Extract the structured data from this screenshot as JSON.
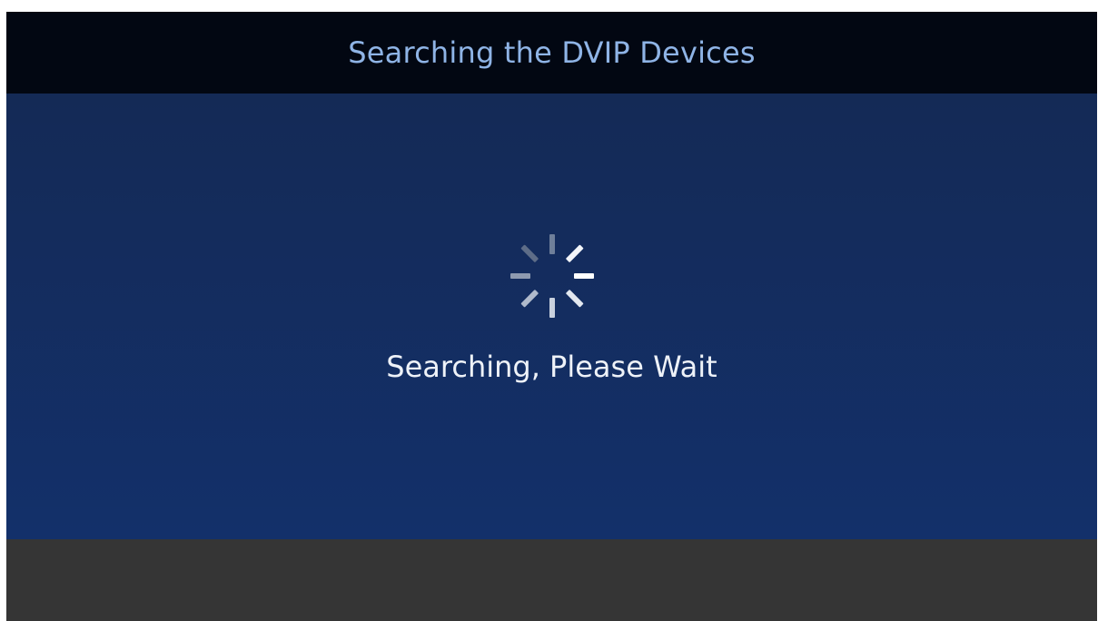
{
  "header": {
    "title": "Searching the DVIP Devices"
  },
  "main": {
    "spinner_icon": "loading-spinner-icon",
    "status_text": "Searching, Please Wait"
  },
  "colors": {
    "header_bg": "#020712",
    "header_text": "#8fb4e6",
    "main_bg_top": "#142a56",
    "main_bg_bottom": "#13306a",
    "status_text": "#eef2f8",
    "footer_bg": "#353535"
  }
}
